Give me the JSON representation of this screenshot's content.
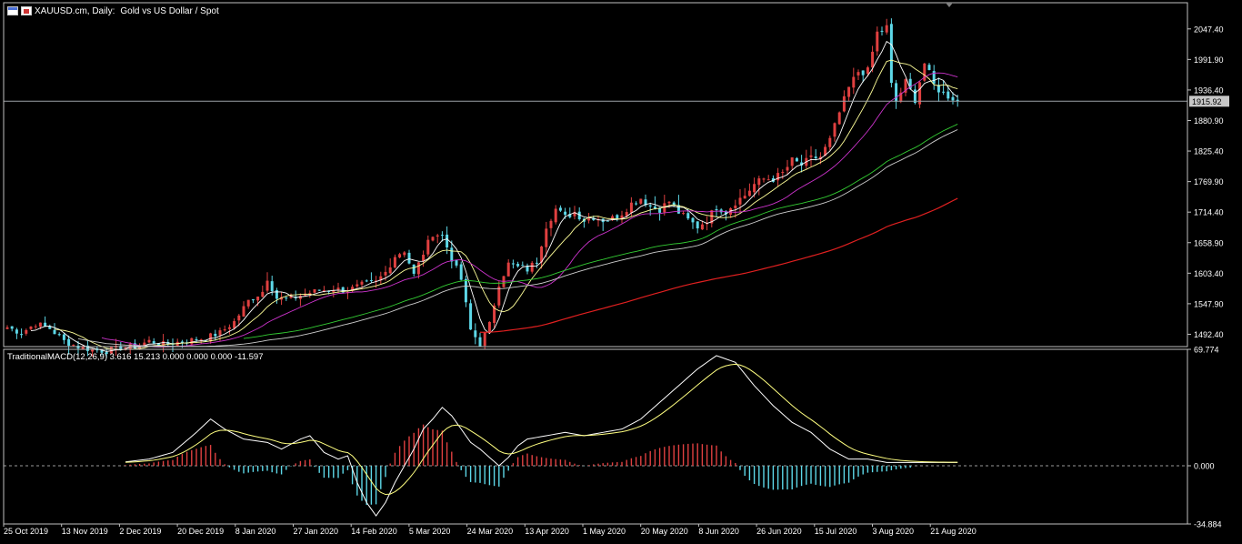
{
  "header": {
    "symbol": "XAUUSD.cm, Daily:",
    "description": "Gold vs US Dollar / Spot"
  },
  "icons": [
    "window-icon",
    "symbol-icon"
  ],
  "chart_data": [
    {
      "type": "candlestick",
      "title": "XAUUSD.cm, Daily:  Gold vs US Dollar / Spot",
      "y_ticks": [
        "2047.40",
        "1991.90",
        "1936.40",
        "1880.90",
        "1825.40",
        "1769.90",
        "1714.40",
        "1658.90",
        "1603.40",
        "1547.90",
        "1492.40"
      ],
      "ylim": [
        1470,
        2095
      ],
      "x_labels": [
        "25 Oct 2019",
        "13 Nov 2019",
        "2 Dec 2019",
        "20 Dec 2019",
        "8 Jan 2020",
        "27 Jan 2020",
        "14 Feb 2020",
        "5 Mar 2020",
        "24 Mar 2020",
        "13 Apr 2020",
        "1 May 2020",
        "20 May 2020",
        "8 Jun 2020",
        "26 Jun 2020",
        "15 Jul 2020",
        "3 Aug 2020",
        "21 Aug 2020"
      ],
      "current_price": 1915.92,
      "current_price_label": "1915.92",
      "anchor_closes": [
        [
          0,
          1505
        ],
        [
          3,
          1495
        ],
        [
          6,
          1512
        ],
        [
          9,
          1503
        ],
        [
          12,
          1480
        ],
        [
          15,
          1470
        ],
        [
          18,
          1464
        ],
        [
          21,
          1462
        ],
        [
          24,
          1468
        ],
        [
          27,
          1470
        ],
        [
          30,
          1480
        ],
        [
          33,
          1474
        ],
        [
          36,
          1478
        ],
        [
          39,
          1482
        ],
        [
          42,
          1486
        ],
        [
          45,
          1495
        ],
        [
          48,
          1515
        ],
        [
          51,
          1553
        ],
        [
          54,
          1570
        ],
        [
          55,
          1595
        ],
        [
          57,
          1558
        ],
        [
          60,
          1557
        ],
        [
          63,
          1566
        ],
        [
          66,
          1572
        ],
        [
          69,
          1575
        ],
        [
          72,
          1572
        ],
        [
          75,
          1582
        ],
        [
          78,
          1587
        ],
        [
          80,
          1605
        ],
        [
          82,
          1635
        ],
        [
          84,
          1645
        ],
        [
          86,
          1600
        ],
        [
          88,
          1640
        ],
        [
          90,
          1676
        ],
        [
          92,
          1672
        ],
        [
          94,
          1630
        ],
        [
          96,
          1592
        ],
        [
          98,
          1500
        ],
        [
          100,
          1475
        ],
        [
          102,
          1510
        ],
        [
          104,
          1585
        ],
        [
          106,
          1620
        ],
        [
          108,
          1614
        ],
        [
          110,
          1610
        ],
        [
          112,
          1626
        ],
        [
          114,
          1690
        ],
        [
          116,
          1720
        ],
        [
          118,
          1705
        ],
        [
          120,
          1715
        ],
        [
          122,
          1700
        ],
        [
          124,
          1706
        ],
        [
          126,
          1700
        ],
        [
          128,
          1703
        ],
        [
          130,
          1713
        ],
        [
          132,
          1730
        ],
        [
          134,
          1740
        ],
        [
          136,
          1725
        ],
        [
          138,
          1720
        ],
        [
          140,
          1734
        ],
        [
          142,
          1714
        ],
        [
          144,
          1700
        ],
        [
          146,
          1688
        ],
        [
          148,
          1700
        ],
        [
          150,
          1725
        ],
        [
          152,
          1715
        ],
        [
          154,
          1733
        ],
        [
          156,
          1745
        ],
        [
          158,
          1765
        ],
        [
          160,
          1775
        ],
        [
          162,
          1775
        ],
        [
          164,
          1785
        ],
        [
          166,
          1808
        ],
        [
          168,
          1800
        ],
        [
          170,
          1812
        ],
        [
          172,
          1815
        ],
        [
          174,
          1845
        ],
        [
          176,
          1895
        ],
        [
          178,
          1940
        ],
        [
          180,
          1970
        ],
        [
          182,
          1970
        ],
        [
          184,
          2040
        ],
        [
          186,
          2050
        ],
        [
          187,
          1945
        ],
        [
          188,
          1915
        ],
        [
          190,
          1950
        ],
        [
          192,
          1920
        ],
        [
          194,
          1985
        ],
        [
          196,
          1945
        ],
        [
          198,
          1930
        ],
        [
          200,
          1922
        ],
        [
          201,
          1915.92
        ]
      ],
      "moving_averages": [
        {
          "color": "#ffffff"
        },
        {
          "color": "#ffff99"
        },
        {
          "color": "#cc33cc"
        },
        {
          "color": "#33cc33"
        },
        {
          "color": "#cccccc"
        },
        {
          "color": "#e02020"
        }
      ],
      "up_color": "#e04040",
      "down_color": "#5dd8e8"
    },
    {
      "type": "macd",
      "label": "TraditionalMACD(12,26,9) 3.616 15.213 0.000 0.000 0.000 -11.597",
      "y_ticks": [
        "69.774",
        "0.000",
        "-34.884"
      ],
      "ylim": [
        -34.884,
        69.774
      ],
      "macd_anchors": [
        [
          24,
          2
        ],
        [
          30,
          4
        ],
        [
          35,
          8
        ],
        [
          40,
          20
        ],
        [
          43,
          28
        ],
        [
          46,
          22
        ],
        [
          50,
          16
        ],
        [
          55,
          14
        ],
        [
          58,
          10
        ],
        [
          62,
          16
        ],
        [
          64,
          18
        ],
        [
          67,
          8
        ],
        [
          70,
          4
        ],
        [
          72,
          6
        ],
        [
          74,
          -10
        ],
        [
          76,
          -22
        ],
        [
          78,
          -30
        ],
        [
          80,
          -22
        ],
        [
          82,
          -10
        ],
        [
          84,
          0
        ],
        [
          86,
          10
        ],
        [
          88,
          22
        ],
        [
          90,
          28
        ],
        [
          92,
          35
        ],
        [
          94,
          30
        ],
        [
          96,
          22
        ],
        [
          98,
          14
        ],
        [
          100,
          10
        ],
        [
          102,
          5
        ],
        [
          104,
          0
        ],
        [
          106,
          5
        ],
        [
          108,
          12
        ],
        [
          110,
          16
        ],
        [
          114,
          18
        ],
        [
          118,
          20
        ],
        [
          122,
          18
        ],
        [
          126,
          20
        ],
        [
          130,
          22
        ],
        [
          134,
          28
        ],
        [
          138,
          38
        ],
        [
          142,
          48
        ],
        [
          146,
          58
        ],
        [
          150,
          66
        ],
        [
          154,
          62
        ],
        [
          158,
          48
        ],
        [
          162,
          36
        ],
        [
          166,
          26
        ],
        [
          170,
          20
        ],
        [
          174,
          10
        ],
        [
          178,
          4
        ],
        [
          182,
          4
        ],
        [
          186,
          2
        ]
      ],
      "signal_color": "#ffff80",
      "macd_color": "#ffffff",
      "hist_up_color": "#e04040",
      "hist_down_color": "#5dd8e8"
    }
  ]
}
